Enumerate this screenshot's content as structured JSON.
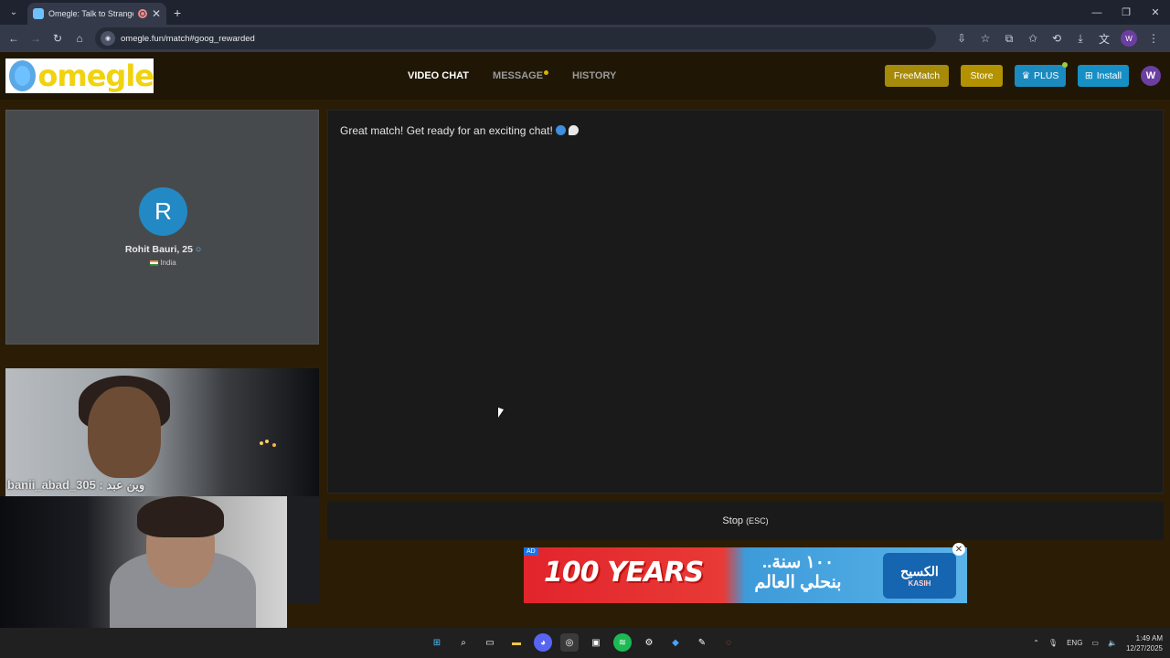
{
  "browser": {
    "tab_title": "Omegle: Talk to Strangers w",
    "url": "omegle.fun/match#goog_rewarded",
    "profile_initial": "W"
  },
  "header": {
    "logo_text": "omegle",
    "nav": {
      "video_chat": "VIDEO CHAT",
      "message": "MESSAGE",
      "history": "HISTORY"
    },
    "buttons": {
      "freematch": "FreeMatch",
      "store": "Store",
      "plus": "PLUS",
      "install": "Install"
    },
    "user_initial": "W"
  },
  "partner": {
    "initial": "R",
    "name": "Rohit Bauri, 25",
    "country": "India"
  },
  "remote_video": {
    "caption": "banii_abad_305 : وين عبد"
  },
  "chat": {
    "message": "Great match! Get ready for an exciting chat!"
  },
  "controls": {
    "stop_label": "Stop",
    "stop_hint": "(ESC)"
  },
  "ad": {
    "tag": "AD",
    "headline": "100 YEARS",
    "arabic_line1": "..١٠٠ سنة",
    "arabic_line2": "بنحلي العالم",
    "brand": "الكسيح",
    "brand_sub": "KASIH"
  },
  "taskbar": {
    "language": "ENG",
    "time": "1:49 AM",
    "date": "12/27/2025"
  },
  "colors": {
    "freematch": "#a68a0a",
    "store": "#b39200",
    "plus": "#1b8abf",
    "install": "#1690c4",
    "page_bg": "#2b1d05"
  }
}
